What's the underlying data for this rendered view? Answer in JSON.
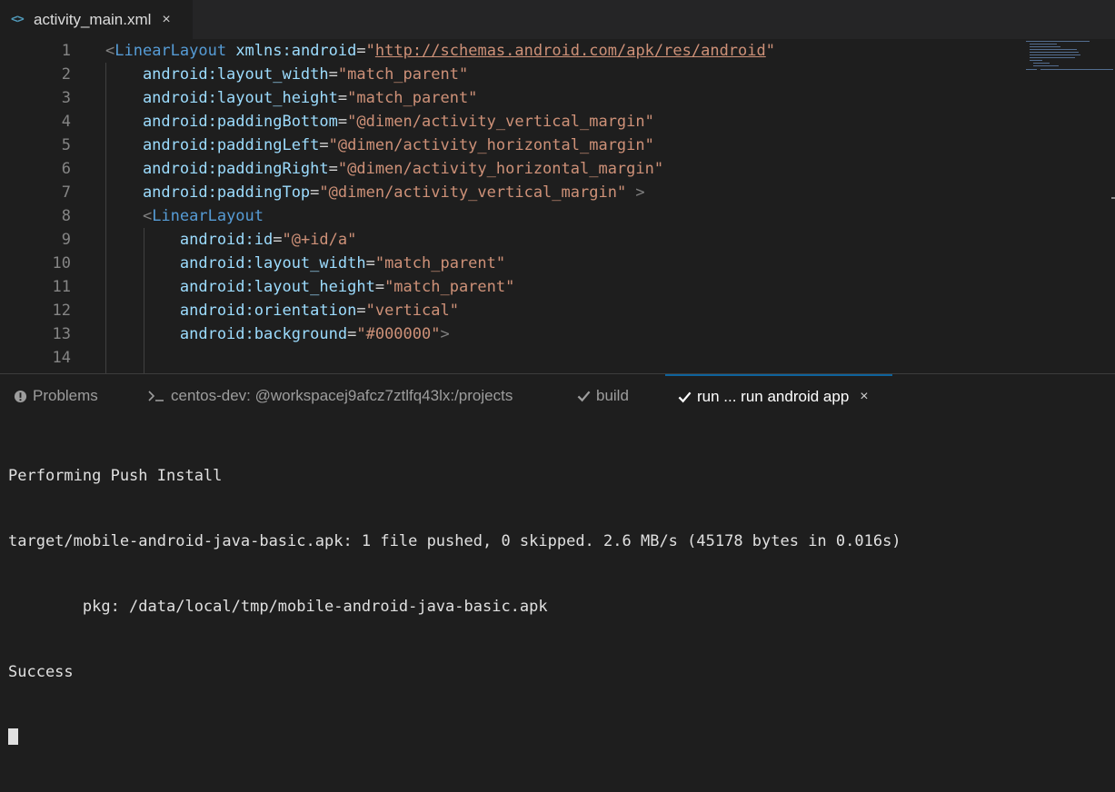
{
  "editor_tab": {
    "icon": "xml-code-icon",
    "icon_glyph": "<>",
    "label": "activity_main.xml",
    "close": "×"
  },
  "code_lines": [
    {
      "n": "1",
      "tokens": [
        [
          "bracket",
          "<"
        ],
        [
          "tag",
          "LinearLayout"
        ],
        [
          "attr",
          " xmlns:android"
        ],
        [
          "eq",
          "="
        ],
        [
          "str",
          "\""
        ],
        [
          "url",
          "http://schemas.android.com/apk/res/android"
        ],
        [
          "str",
          "\""
        ]
      ]
    },
    {
      "n": "2",
      "tokens": [
        [
          "attr",
          "    android:layout_width"
        ],
        [
          "eq",
          "="
        ],
        [
          "str",
          "\"match_parent\""
        ]
      ]
    },
    {
      "n": "3",
      "tokens": [
        [
          "attr",
          "    android:layout_height"
        ],
        [
          "eq",
          "="
        ],
        [
          "str",
          "\"match_parent\""
        ]
      ]
    },
    {
      "n": "4",
      "tokens": [
        [
          "attr",
          "    android:paddingBottom"
        ],
        [
          "eq",
          "="
        ],
        [
          "str",
          "\"@dimen/activity_vertical_margin\""
        ]
      ]
    },
    {
      "n": "5",
      "tokens": [
        [
          "attr",
          "    android:paddingLeft"
        ],
        [
          "eq",
          "="
        ],
        [
          "str",
          "\"@dimen/activity_horizontal_margin\""
        ]
      ]
    },
    {
      "n": "6",
      "tokens": [
        [
          "attr",
          "    android:paddingRight"
        ],
        [
          "eq",
          "="
        ],
        [
          "str",
          "\"@dimen/activity_horizontal_margin\""
        ]
      ]
    },
    {
      "n": "7",
      "tokens": [
        [
          "attr",
          "    android:paddingTop"
        ],
        [
          "eq",
          "="
        ],
        [
          "str",
          "\"@dimen/activity_vertical_margin\""
        ],
        [
          "bracket",
          " >"
        ]
      ]
    },
    {
      "n": "8",
      "tokens": [
        [
          "bracket",
          "    <"
        ],
        [
          "tag",
          "LinearLayout"
        ]
      ]
    },
    {
      "n": "9",
      "tokens": [
        [
          "attr",
          "        android:id"
        ],
        [
          "eq",
          "="
        ],
        [
          "str",
          "\"@+id/a\""
        ]
      ]
    },
    {
      "n": "10",
      "tokens": [
        [
          "attr",
          "        android:layout_width"
        ],
        [
          "eq",
          "="
        ],
        [
          "str",
          "\"match_parent\""
        ]
      ]
    },
    {
      "n": "11",
      "tokens": [
        [
          "attr",
          "        android:layout_height"
        ],
        [
          "eq",
          "="
        ],
        [
          "str",
          "\"match_parent\""
        ]
      ]
    },
    {
      "n": "12",
      "tokens": [
        [
          "attr",
          "        android:orientation"
        ],
        [
          "eq",
          "="
        ],
        [
          "str",
          "\"vertical\""
        ]
      ]
    },
    {
      "n": "13",
      "tokens": [
        [
          "attr",
          "        android:background"
        ],
        [
          "eq",
          "="
        ],
        [
          "str",
          "\"#000000\""
        ],
        [
          "bracket",
          ">"
        ]
      ]
    },
    {
      "n": "14",
      "tokens": []
    }
  ],
  "panel": {
    "tabs": [
      {
        "icon": "problems-icon",
        "label": "Problems",
        "active": false
      },
      {
        "icon": "terminal-icon",
        "label": "centos-dev: @workspacej9afcz7ztlfq43lx:/projects",
        "active": false
      },
      {
        "icon": "check-icon",
        "label": "build",
        "active": false
      },
      {
        "icon": "check-icon",
        "label": "run ... run android app",
        "active": true,
        "close": "×"
      }
    ],
    "terminal_lines": [
      "Performing Push Install",
      "target/mobile-android-java-basic.apk: 1 file pushed, 0 skipped. 2.6 MB/s (45178 bytes in 0.016s)",
      "        pkg: /data/local/tmp/mobile-android-java-basic.apk",
      "Success"
    ]
  },
  "colors": {
    "background": "#1e1e1e",
    "tag": "#569cd6",
    "attribute": "#9cdcfe",
    "string": "#ce9178",
    "active_tab_border": "#0e639c"
  }
}
